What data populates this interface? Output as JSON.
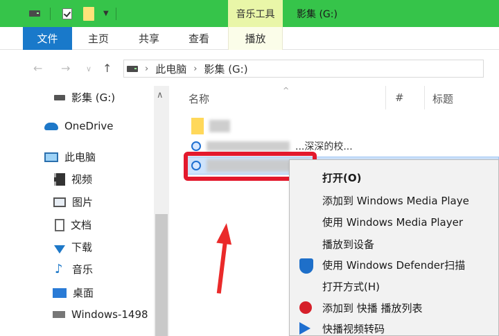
{
  "titlebar": {
    "context_tab": "音乐工具",
    "title": "影集 (G:)"
  },
  "ribbon": {
    "tabs": [
      {
        "label": "文件"
      },
      {
        "label": "主页"
      },
      {
        "label": "共享"
      },
      {
        "label": "查看"
      },
      {
        "label": "播放"
      }
    ]
  },
  "address": {
    "path": [
      "此电脑",
      "影集 (G:)"
    ],
    "sep": "›"
  },
  "sidebar": {
    "items": [
      {
        "label": "影集 (G:)",
        "icon": "drive-icon"
      },
      {
        "label": "OneDrive",
        "icon": "onedrive-icon"
      },
      {
        "label": "此电脑",
        "icon": "computer-icon"
      },
      {
        "label": "视频",
        "icon": "video-icon"
      },
      {
        "label": "图片",
        "icon": "picture-icon"
      },
      {
        "label": "文档",
        "icon": "document-icon"
      },
      {
        "label": "下载",
        "icon": "download-icon"
      },
      {
        "label": "音乐",
        "icon": "music-icon"
      },
      {
        "label": "桌面",
        "icon": "desktop-icon"
      },
      {
        "label": "Windows-1498",
        "icon": "drive-icon"
      }
    ]
  },
  "filelist": {
    "columns": [
      "名称",
      "#",
      "标题"
    ],
    "rows": [
      {
        "name": "",
        "type": "folder"
      },
      {
        "name": "...深深的校...",
        "type": "media"
      },
      {
        "name": "",
        "type": "media"
      }
    ]
  },
  "context_menu": {
    "items": [
      {
        "label": "打开(O)",
        "bold": true
      },
      {
        "label": "添加到 Windows Media Playe"
      },
      {
        "label": "使用 Windows Media Player"
      },
      {
        "label": "播放到设备"
      },
      {
        "label": "使用 Windows Defender扫描",
        "icon": "defender-shield-icon"
      },
      {
        "label": "打开方式(H)"
      },
      {
        "label": "添加到 快播 播放列表",
        "icon": "qvod-icon"
      },
      {
        "label": "快播视频转码",
        "icon": "convert-icon"
      }
    ]
  },
  "colors": {
    "titlebar_green": "#36c44a",
    "file_tab_blue": "#1979ca",
    "highlight_red": "#e3192d"
  }
}
